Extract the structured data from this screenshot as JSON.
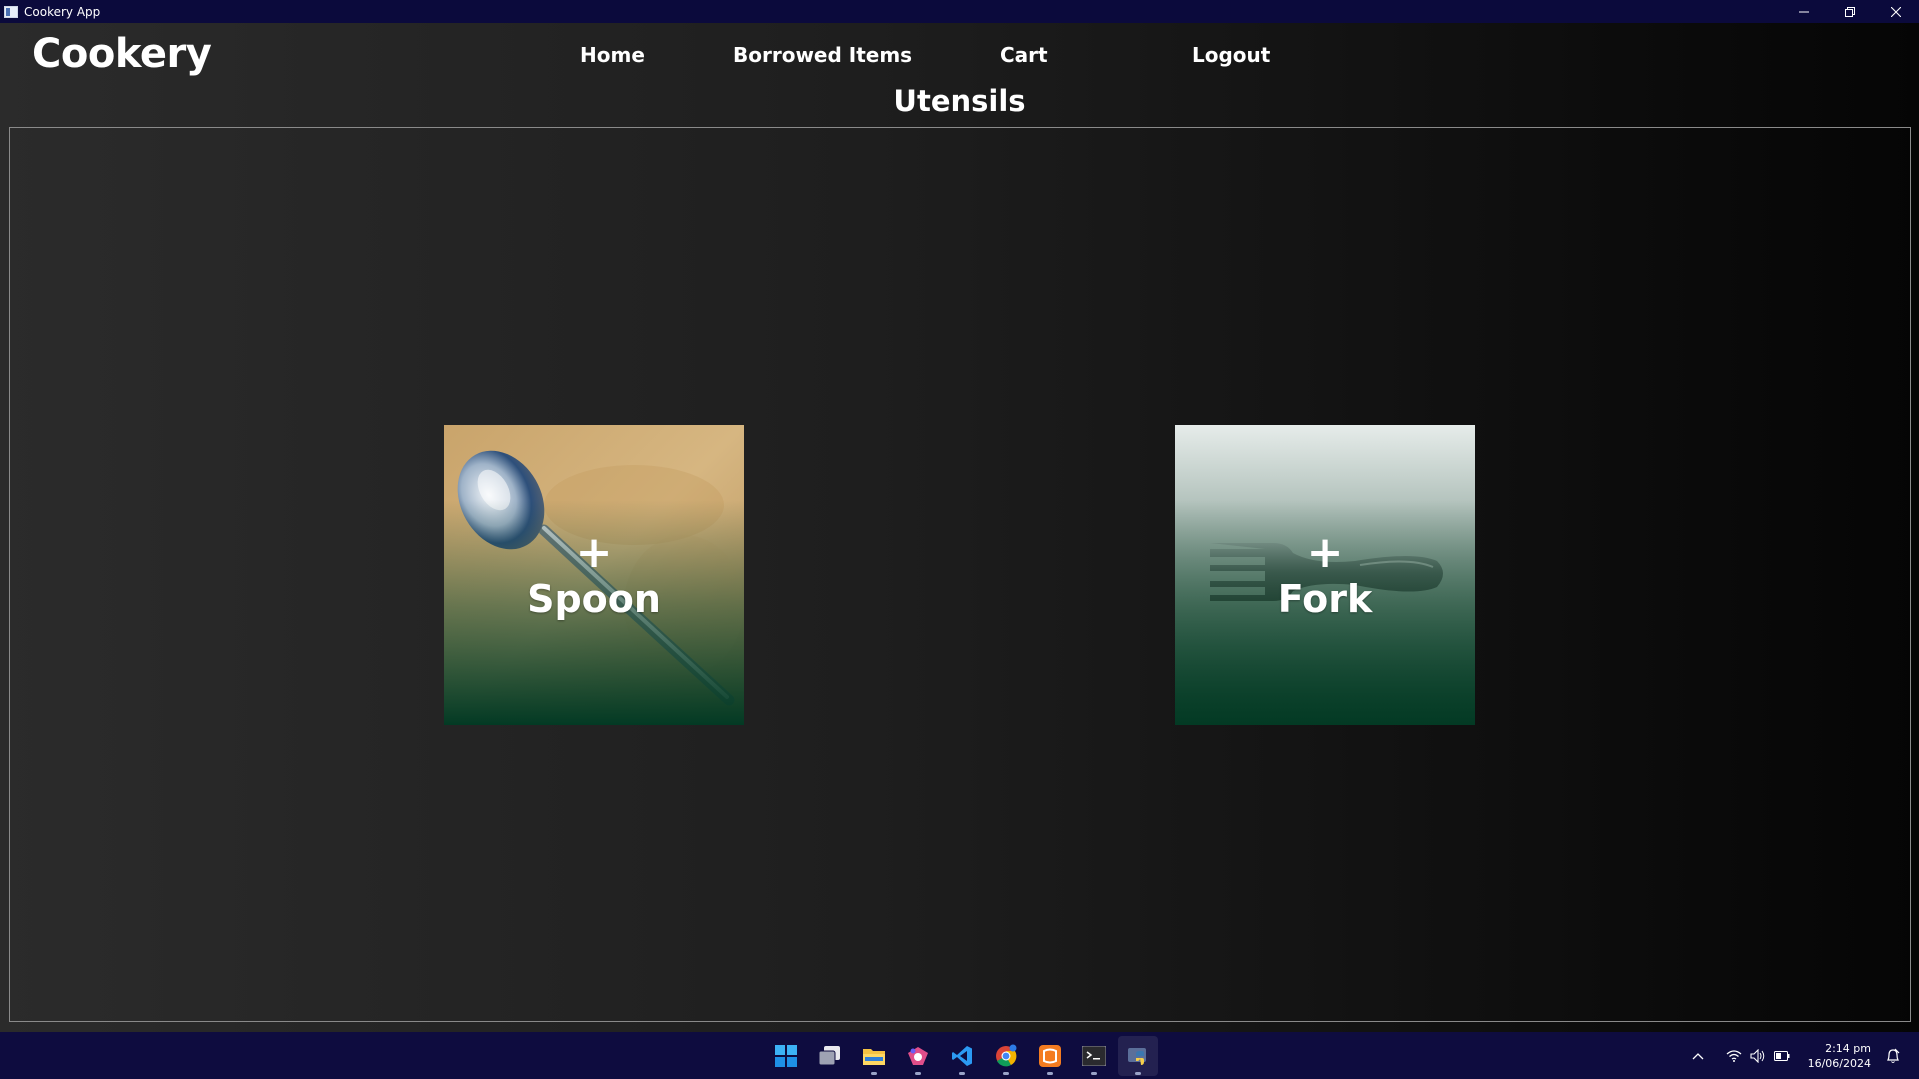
{
  "window": {
    "title": "Cookery App"
  },
  "app": {
    "brand": "Cookery",
    "nav": [
      {
        "label": "Home"
      },
      {
        "label": "Borrowed Items"
      },
      {
        "label": "Cart"
      },
      {
        "label": "Logout"
      }
    ],
    "page_title": "Utensils",
    "items": [
      {
        "plus": "+",
        "name": "Spoon"
      },
      {
        "plus": "+",
        "name": "Fork"
      }
    ]
  },
  "taskbar": {
    "apps": [
      "start-icon",
      "task-view-icon",
      "file-explorer-icon",
      "visual-studio-icon",
      "vscode-icon",
      "chrome-icon",
      "xampp-icon",
      "terminal-icon",
      "python-app-icon"
    ],
    "clock": {
      "time": "2:14 pm",
      "date": "16/06/2024"
    }
  },
  "colors": {
    "titlebar": "#0b0a3c",
    "taskbar": "#0e0c3f",
    "card_overlay": "#033a24"
  }
}
